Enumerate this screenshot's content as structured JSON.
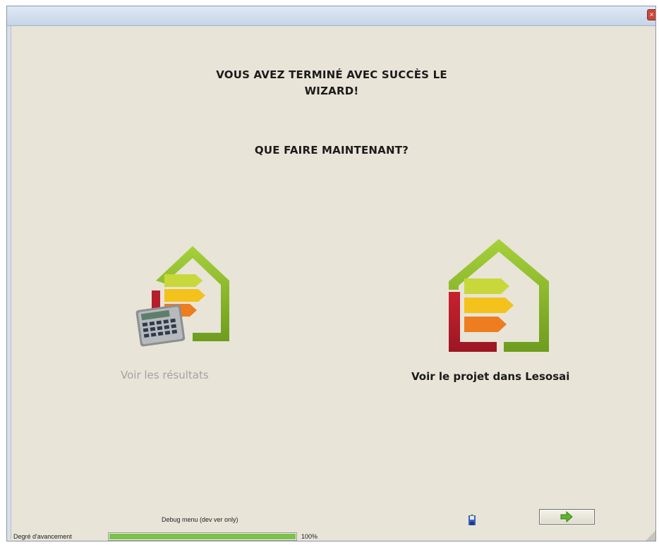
{
  "window": {
    "close_icon": "close-icon"
  },
  "content": {
    "heading_line1": "VOUS AVEZ TERMINÉ AVEC SUCCÈS LE",
    "heading_line2": "WIZARD!",
    "question": "QUE FAIRE MAINTENANT?"
  },
  "choices": [
    {
      "label": "Voir les résultats",
      "icon": "house-energy-calculator-icon",
      "state": "disabled"
    },
    {
      "label": "Voir le projet dans Lesosai",
      "icon": "lesosai-house-energy-icon",
      "state": "enabled"
    }
  ],
  "footer": {
    "debug_label": "Debug menu (dev ver only)",
    "save_icon": "save-icon",
    "next_icon": "arrow-right-icon",
    "progress_label": "Degré d'avancement",
    "progress_value": 100,
    "progress_text": "100%"
  },
  "colors": {
    "background": "#e8e4d7",
    "progress": "#7cc14a",
    "house_green": "#8cbf2c",
    "house_red": "#b51e2b",
    "disabled_text": "#a3a3a3"
  }
}
